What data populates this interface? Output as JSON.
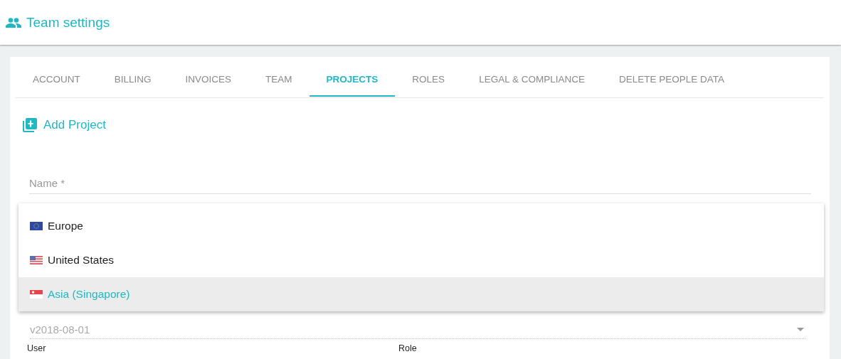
{
  "header": {
    "title": "Team settings"
  },
  "tabs": [
    {
      "label": "ACCOUNT",
      "selected": false
    },
    {
      "label": "BILLING",
      "selected": false
    },
    {
      "label": "INVOICES",
      "selected": false
    },
    {
      "label": "TEAM",
      "selected": false
    },
    {
      "label": "PROJECTS",
      "selected": true
    },
    {
      "label": "ROLES",
      "selected": false
    },
    {
      "label": "LEGAL & COMPLIANCE",
      "selected": false
    },
    {
      "label": "DELETE PEOPLE DATA",
      "selected": false
    }
  ],
  "add_button": "Add Project",
  "name_field": {
    "placeholder": "Name *"
  },
  "region_menu": [
    {
      "label": "Europe",
      "kind": "eu",
      "selected": false
    },
    {
      "label": "United States",
      "kind": "us",
      "selected": false
    },
    {
      "label": "Asia (Singapore)",
      "kind": "sg",
      "selected": true
    }
  ],
  "version_select": {
    "value": "v2018-08-01"
  },
  "columns": [
    "User",
    "Role"
  ]
}
